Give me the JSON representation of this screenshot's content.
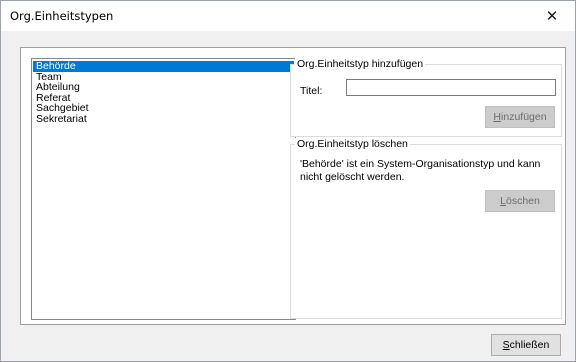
{
  "window": {
    "title": "Org.Einheitstypen",
    "close_glyph": "✕"
  },
  "list": {
    "items": [
      {
        "label": "Behörde",
        "selected": true
      },
      {
        "label": "Team",
        "selected": false
      },
      {
        "label": "Abteilung",
        "selected": false
      },
      {
        "label": "Referat",
        "selected": false
      },
      {
        "label": "Sachgebiet",
        "selected": false
      },
      {
        "label": "Sekretariat",
        "selected": false
      }
    ]
  },
  "add_group": {
    "title": "Org.Einheitstyp hinzufügen",
    "field_label": "Titel:",
    "field_value": "",
    "button_mnemonic": "H",
    "button_rest": "inzufügen",
    "button_enabled": false
  },
  "delete_group": {
    "title": "Org.Einheitstyp löschen",
    "message": "'Behörde' ist ein System-Organisationstyp und kann nicht gelöscht werden.",
    "button_mnemonic": "L",
    "button_rest": "öschen",
    "button_enabled": false
  },
  "footer": {
    "close_mnemonic": "S",
    "close_rest": "chließen"
  },
  "colors": {
    "selection": "#0078d7",
    "disabled_button_bg": "#cccccc",
    "disabled_button_text": "#6d6d6d"
  }
}
